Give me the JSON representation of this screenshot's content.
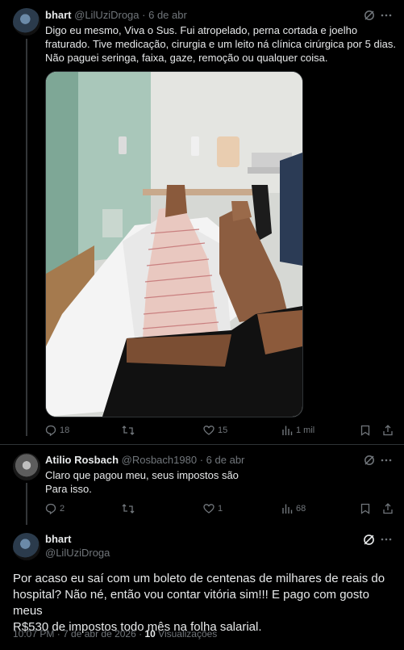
{
  "post1": {
    "name": "bhart",
    "handle": "@LilUziDroga",
    "sep": "·",
    "date": "6 de abr",
    "text_lines": [
      "Digo eu mesmo, Viva o Sus. Fui atropelado, perna cortada e joelho",
      "fraturado. Tive medicação, cirurgia e um leito ná clínica cirúrgica por 5 dias.",
      "Não paguei seringa, faixa, gaze, remoção ou qualquer coisa."
    ],
    "replies": "18",
    "likes": "15",
    "views": "1 mil"
  },
  "post2": {
    "name": "Atilio Rosbach",
    "handle": "@Rosbach1980",
    "sep": "·",
    "date": "6 de abr",
    "text_lines": [
      "Claro que pagou meu, seus impostos são",
      "Para isso."
    ],
    "replies": "2",
    "likes": "1",
    "views": "68"
  },
  "post3": {
    "name": "bhart",
    "handle": "@LilUziDroga",
    "text_lines": [
      "Por acaso eu saí com um boleto de centenas de milhares de reais do",
      "hospital? Não né, então vou contar vitória sim!!! E pago com gosto meus",
      "R$530 de impostos todo mês na folha salarial."
    ],
    "timestamp": "10:07 PM · 7 de abr de 2026 ·",
    "views_count": "10",
    "views_label": "Visualizações"
  },
  "colors": {
    "bg": "#000000",
    "text": "#e7e9ea",
    "muted": "#71767b",
    "border": "#2f3336"
  }
}
